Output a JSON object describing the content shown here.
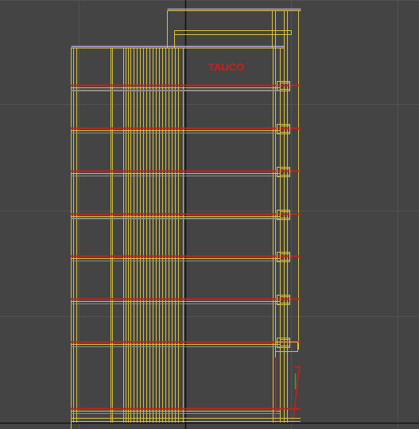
{
  "viewport": {
    "background": "#444444",
    "grid_color": "#525252",
    "axis_color": "#111111",
    "wire_color": "#d8c23a",
    "slab_color": "#c8201c",
    "roof_color": "#b9a7d6",
    "sign_text": "TAUCO"
  }
}
